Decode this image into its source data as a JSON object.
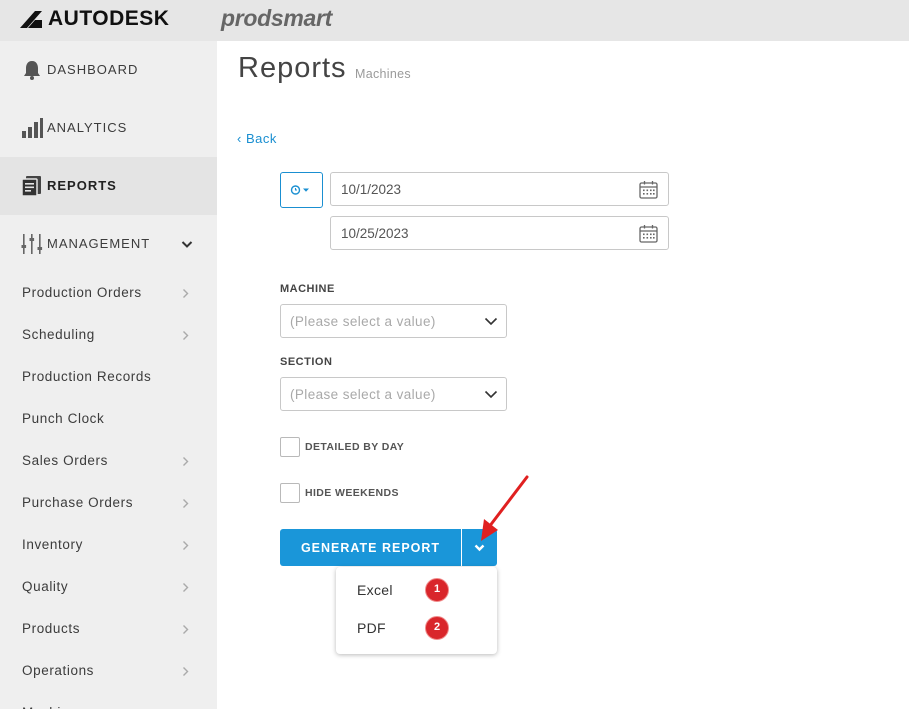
{
  "header": {
    "brand": "AUTODESK",
    "product": "prodsmart"
  },
  "sidebar": {
    "main_items": [
      {
        "label": "DASHBOARD",
        "icon": "bell-icon"
      },
      {
        "label": "ANALYTICS",
        "icon": "bar-chart-icon"
      },
      {
        "label": "REPORTS",
        "icon": "reports-icon",
        "active": true
      },
      {
        "label": "MANAGEMENT",
        "icon": "sliders-icon",
        "expanded": true
      }
    ],
    "sub_items": [
      {
        "label": "Production Orders",
        "has_arrow": true
      },
      {
        "label": "Scheduling",
        "has_arrow": true
      },
      {
        "label": "Production Records",
        "has_arrow": false
      },
      {
        "label": "Punch Clock",
        "has_arrow": false
      },
      {
        "label": "Sales Orders",
        "has_arrow": true
      },
      {
        "label": "Purchase Orders",
        "has_arrow": true
      },
      {
        "label": "Inventory",
        "has_arrow": true
      },
      {
        "label": "Quality",
        "has_arrow": true
      },
      {
        "label": "Products",
        "has_arrow": true
      },
      {
        "label": "Operations",
        "has_arrow": true
      },
      {
        "label": "Machines",
        "has_arrow": true
      }
    ]
  },
  "main": {
    "title": "Reports",
    "subtitle": "Machines",
    "back_label": "‹ Back",
    "start_date": "10/1/2023",
    "end_date": "10/25/2023",
    "machine_label": "MACHINE",
    "machine_placeholder": "(Please select a value)",
    "section_label": "SECTION",
    "section_placeholder": "(Please select a value)",
    "detailed_by_day_label": "DETAILED BY DAY",
    "detailed_by_day_checked": false,
    "hide_weekends_label": "HIDE WEEKENDS",
    "hide_weekends_checked": false,
    "generate_label": "GENERATE REPORT",
    "export_options": [
      {
        "label": "Excel",
        "badge": "1"
      },
      {
        "label": "PDF",
        "badge": "2"
      }
    ]
  },
  "colors": {
    "accent": "#1a96d9",
    "link": "#1a8fd1",
    "sidebar_bg": "#efefef",
    "topbar_bg": "#e6e6e6",
    "badge": "#d9262b",
    "annotation_arrow": "#e02020"
  }
}
